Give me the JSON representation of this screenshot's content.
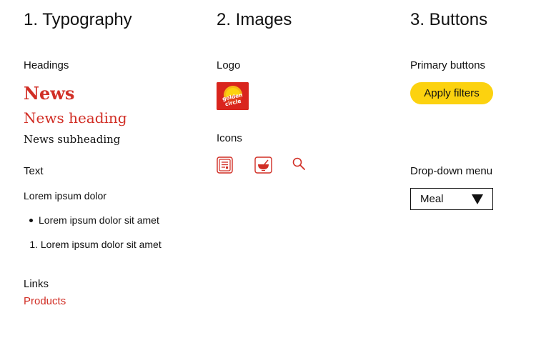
{
  "typography": {
    "title": "1. Typography",
    "headings_label": "Headings",
    "news_xl": "News",
    "news_heading": "News heading",
    "news_subheading": "News subheading",
    "text_label": "Text",
    "paragraph": "Lorem ipsum dolor",
    "bullet_item": "Lorem ipsum dolor sit amet",
    "numbered_marker": "1.",
    "numbered_item": "Lorem ipsum dolor sit amet",
    "links_label": "Links",
    "link_text": "Products"
  },
  "images": {
    "title": "2. Images",
    "logo_label": "Logo",
    "logo_text_line1": "golden",
    "logo_text_line2": "circle",
    "icons_label": "Icons",
    "icons": [
      "recipe-card-icon",
      "bowl-icon",
      "search-icon"
    ]
  },
  "buttons": {
    "title": "3. Buttons",
    "primary_label": "Primary buttons",
    "primary_button": "Apply filters",
    "dropdown_label": "Drop-down menu",
    "dropdown_value": "Meal"
  },
  "colors": {
    "brand_red": "#d12e25",
    "primary_yellow": "#fcd20f",
    "text": "#111111"
  }
}
